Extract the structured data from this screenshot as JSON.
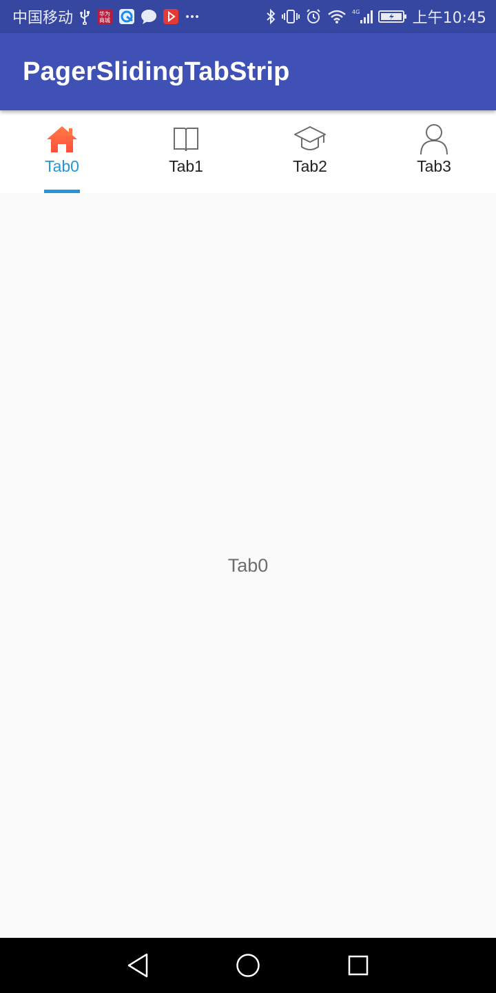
{
  "status_bar": {
    "carrier": "中国移动",
    "time": "上午10:45",
    "icons": [
      "usb-icon",
      "app-notification-icon",
      "browser-icon",
      "chat-icon",
      "video-icon",
      "more-icon",
      "bluetooth-icon",
      "vibrate-icon",
      "alarm-icon",
      "wifi-icon",
      "signal-4g-icon",
      "battery-icon"
    ]
  },
  "app_bar": {
    "title": "PagerSlidingTabStrip"
  },
  "tabs": [
    {
      "label": "Tab0",
      "icon": "home-icon",
      "active": true
    },
    {
      "label": "Tab1",
      "icon": "book-icon",
      "active": false
    },
    {
      "label": "Tab2",
      "icon": "graduation-cap-icon",
      "active": false
    },
    {
      "label": "Tab3",
      "icon": "user-icon",
      "active": false
    }
  ],
  "content": {
    "text": "Tab0"
  },
  "nav_bar": {
    "buttons": [
      "back-icon",
      "home-circle-icon",
      "recents-icon"
    ]
  },
  "colors": {
    "status_bar": "#3547a1",
    "app_bar": "#3f51b5",
    "accent": "#2196d8",
    "home_icon": "#ff5a3c",
    "content_bg": "#fafafa"
  }
}
